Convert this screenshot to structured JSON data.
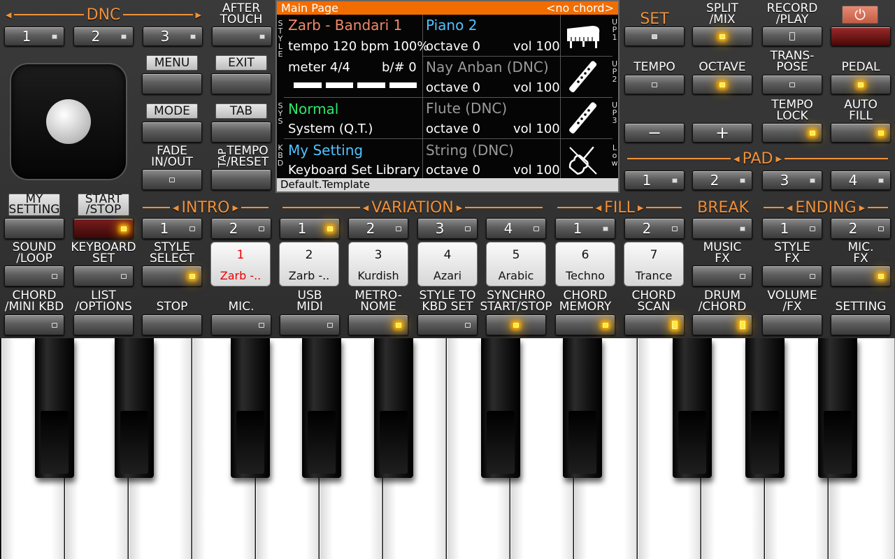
{
  "dnc": {
    "header": "DNC",
    "buttons": [
      "1",
      "2",
      "3"
    ]
  },
  "after_touch": "AFTER\nTOUCH",
  "menu": "MENU",
  "exit": "EXIT",
  "mode": "MODE",
  "tab": "TAB",
  "fade": "FADE\nIN/OUT",
  "tap": "TAP",
  "tempo_reset": "TEMPO\n/RESET",
  "my_setting": "MY\nSETTING",
  "start_stop": "START\n/STOP",
  "screen": {
    "title": "Main Page",
    "chord": "<no chord>",
    "side_left": [
      "S",
      "T",
      "Y",
      "L",
      "E",
      "S",
      "Y",
      "S",
      "K",
      "B",
      "D"
    ],
    "style_name": "Zarb - Bandari 1",
    "tempo_line": "tempo 120 bpm 100%",
    "meter": "meter 4/4",
    "bsharp": "b/# 0",
    "sys_name": "Normal",
    "sys_sub": "System (Q.T.)",
    "kbd_name": "My Setting",
    "kbd_sub": "Keyboard Set Library",
    "voices": [
      {
        "name": "Piano 2",
        "octave": "octave  0",
        "vol": "vol 100",
        "tag": "UP1"
      },
      {
        "name": "Nay Anban (DNC)",
        "octave": "octave  0",
        "vol": "vol 100",
        "tag": "UP2"
      },
      {
        "name": "Flute (DNC)",
        "octave": "octave  0",
        "vol": "vol 100",
        "tag": "UP3"
      },
      {
        "name": "String (DNC)",
        "octave": "octave  0",
        "vol": "vol 100",
        "tag": "Low"
      }
    ],
    "footer": "Default.Template"
  },
  "right": {
    "set": "SET",
    "split": "SPLIT\n/MIX",
    "record": "RECORD\n/PLAY",
    "power": "⏻",
    "tempo": "TEMPO",
    "octave": "OCTAVE",
    "transpose": "TRANS-\nPOSE",
    "pedal": "PEDAL",
    "tempo_lock": "TEMPO\nLOCK",
    "auto_fill": "AUTO\nFILL",
    "minus": "−",
    "plus": "+",
    "pad_header": "PAD",
    "pads": [
      "1",
      "2",
      "3",
      "4"
    ]
  },
  "sections": {
    "intro": "INTRO",
    "variation": "VARIATION",
    "fill": "FILL",
    "break": "BREAK",
    "ending": "ENDING"
  },
  "intro_btns": [
    "1",
    "2"
  ],
  "variation_btns": [
    "1",
    "2",
    "3",
    "4"
  ],
  "fill_btns": [
    "1",
    "2"
  ],
  "ending_btns": [
    "1",
    "2"
  ],
  "row3_labels": {
    "sound": "SOUND\n/LOOP",
    "keyboard": "KEYBOARD\nSET",
    "style_select": "STYLE\nSELECT",
    "music_fx": "MUSIC\nFX",
    "style_fx": "STYLE\nFX",
    "mic_fx": "MIC.\nFX"
  },
  "styles": [
    {
      "n": "1",
      "t": "Zarb -.."
    },
    {
      "n": "2",
      "t": "Zarb -.."
    },
    {
      "n": "3",
      "t": "Kurdish"
    },
    {
      "n": "4",
      "t": "Azari"
    },
    {
      "n": "5",
      "t": "Arabic"
    },
    {
      "n": "6",
      "t": "Techno"
    },
    {
      "n": "7",
      "t": "Trance"
    }
  ],
  "row4_labels": [
    "CHORD\n/MINI KBD",
    "LIST\n/OPTIONS",
    "STOP",
    "MIC.",
    "USB\nMIDI",
    "METRO-\nNOME",
    "STYLE TO\nKBD SET",
    "SYNCHRO\nSTART/STOP",
    "CHORD\nMEMORY",
    "CHORD\nSCAN",
    "DRUM\n/CHORD",
    "VOLUME\n/FX",
    "SETTING"
  ],
  "colors": {
    "accent": "#f0913a",
    "screen_bar": "#f26d00",
    "style_name": "#f08a6a",
    "voice_active": "#4fc3ff",
    "sys": "#2ee66a",
    "led_on": "#ffea3a"
  }
}
